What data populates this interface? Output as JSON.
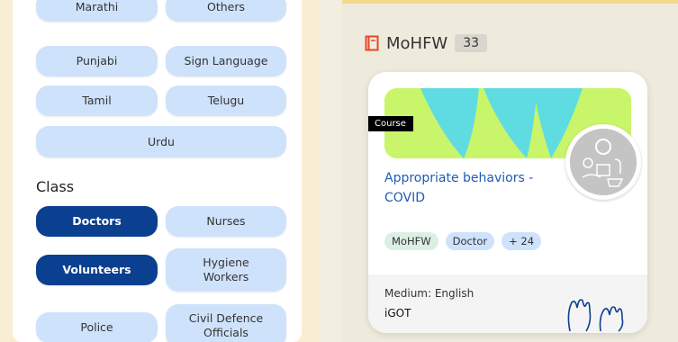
{
  "languages": [
    "Marathi",
    "Others",
    "Punjabi",
    "Sign Language",
    "Tamil",
    "Telugu",
    "Urdu"
  ],
  "class_section": {
    "title": "Class",
    "chips": [
      {
        "label": "Doctors",
        "selected": true
      },
      {
        "label": "Nurses",
        "selected": false
      },
      {
        "label": "Volunteers",
        "selected": true
      },
      {
        "label": "Hygiene Workers",
        "selected": false
      },
      {
        "label": "Police",
        "selected": false
      },
      {
        "label": "Civil Defence Officials",
        "selected": false
      }
    ]
  },
  "group": {
    "icon": "book-icon",
    "title": "MoHFW",
    "count": "33"
  },
  "card": {
    "ribbon": "Course",
    "title": "Appropriate behaviors - COVID",
    "tags": [
      "MoHFW",
      "Doctor",
      "+ 24"
    ],
    "medium": "Medium: English",
    "provider": "iGOT"
  },
  "colors": {
    "accent": "#0b3f8f",
    "chip": "#cfe2fb",
    "banner": "#c8f56a",
    "banner_shape": "#5fdbe2",
    "icon": "#e8452c"
  }
}
